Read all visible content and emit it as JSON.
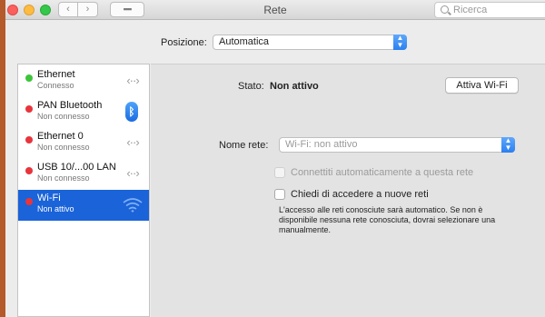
{
  "window": {
    "title": "Rete"
  },
  "search": {
    "placeholder": "Ricerca"
  },
  "toolbar": {
    "back": "‹",
    "forward": "›",
    "grid": "▪▪▪▪"
  },
  "location": {
    "label": "Posizione:",
    "value": "Automatica"
  },
  "services": [
    {
      "name": "Ethernet",
      "status": "Connesso",
      "status_color": "#3ec53a",
      "icon": "connection-arrows-icon"
    },
    {
      "name": "PAN Bluetooth",
      "status": "Non connesso",
      "status_color": "#e8343b",
      "icon": "bluetooth-icon"
    },
    {
      "name": "Ethernet 0",
      "status": "Non connesso",
      "status_color": "#e8343b",
      "icon": "connection-arrows-icon"
    },
    {
      "name": "USB 10/...00 LAN",
      "status": "Non connesso",
      "status_color": "#e8343b",
      "icon": "connection-arrows-icon"
    },
    {
      "name": "Wi-Fi",
      "status": "Non attivo",
      "status_color": "#e8343b",
      "icon": "wifi-icon"
    }
  ],
  "detail": {
    "status_label": "Stato:",
    "status_value": "Non attivo",
    "activate_button": "Attiva Wi-Fi",
    "network_name_label": "Nome rete:",
    "network_name_value": "Wi-Fi: non attivo",
    "auto_join_label": "Connettiti automaticamente a questa rete",
    "ask_join_label": "Chiedi di accedere a nuove reti",
    "ask_join_note": "L'accesso alle reti conosciute sarà automatico. Se non è disponibile nessuna rete conosciuta, dovrai selezionare una manualmente."
  },
  "colors": {
    "accent": "#1a63d9",
    "connected": "#3ec53a",
    "disconnected": "#e8343b"
  }
}
